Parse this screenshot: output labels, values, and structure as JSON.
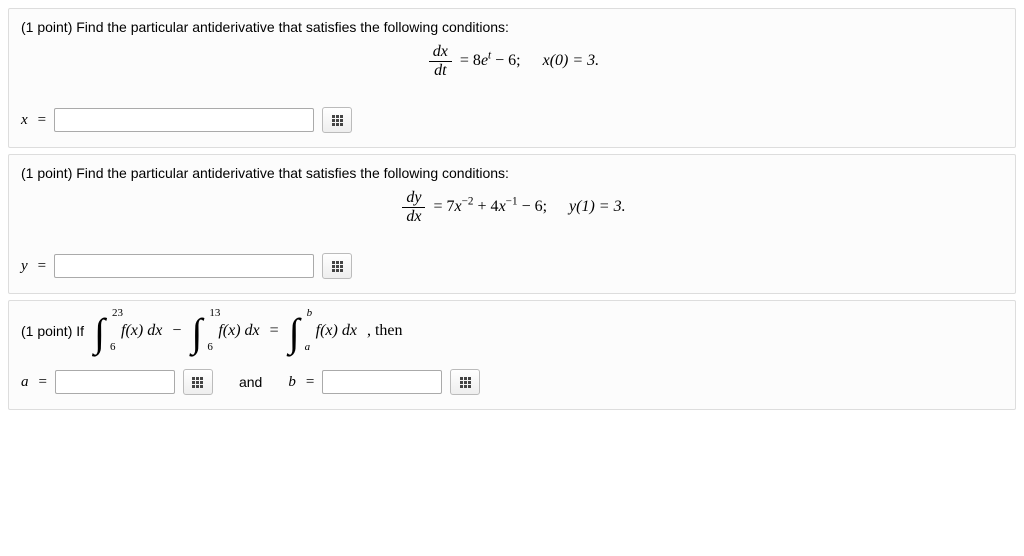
{
  "p1": {
    "prompt": "(1 point) Find the particular antiderivative that satisfies the following conditions:",
    "eq_lhs_num": "dx",
    "eq_lhs_den": "dt",
    "eq_rhs_a": " = 8",
    "eq_rhs_b": "e",
    "eq_rhs_c": "t",
    "eq_rhs_d": " − 6;",
    "cond": "x(0) = 3.",
    "var": "x",
    "eq": " ="
  },
  "p2": {
    "prompt": "(1 point) Find the particular antiderivative that satisfies the following conditions:",
    "eq_lhs_num": "dy",
    "eq_lhs_den": "dx",
    "eq_rhs_a": " = 7",
    "eq_rhs_b": "x",
    "eq_rhs_c": "−2",
    "eq_rhs_d": " + 4",
    "eq_rhs_e": "x",
    "eq_rhs_f": "−1",
    "eq_rhs_g": " − 6;",
    "cond": "y(1) = 3.",
    "var": "y",
    "eq": " ="
  },
  "p3": {
    "lead": "(1 point) If",
    "int1_ub": "23",
    "int1_lb": "6",
    "int2_ub": "13",
    "int2_lb": "6",
    "int3_ub": "b",
    "int3_lb": "a",
    "fx": "f(x) dx",
    "minus": " − ",
    "equals": " = ",
    "comma_then": " ,    then",
    "a_var": "a",
    "b_var": "b",
    "eq": " =",
    "and": "and"
  }
}
